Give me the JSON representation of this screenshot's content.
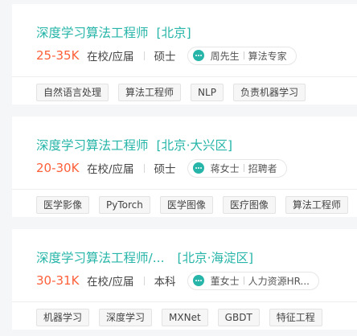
{
  "jobs": [
    {
      "title": "深度学习算法工程师",
      "city": "[北京]",
      "salary": "25-35K",
      "condition": "在校/应届",
      "degree": "硕士",
      "recruiter_name": "周先生",
      "recruiter_role": "算法专家",
      "tags": [
        "自然语言处理",
        "算法工程师",
        "NLP",
        "负责机器学习"
      ]
    },
    {
      "title": "深度学习算法工程师",
      "city": "[北京·大兴区]",
      "salary": "20-30K",
      "condition": "在校/应届",
      "degree": "硕士",
      "recruiter_name": "蒋女士",
      "recruiter_role": "招聘者",
      "tags": [
        "医学影像",
        "PyTorch",
        "医学图像",
        "医疗图像",
        "算法工程师"
      ]
    },
    {
      "title": "深度学习算法工程师/...",
      "city": "[北京·海淀区]",
      "salary": "30-31K",
      "condition": "在校/应届",
      "degree": "本科",
      "recruiter_name": "董女士",
      "recruiter_role": "人力资源HR...",
      "tags": [
        "机器学习",
        "深度学习",
        "MXNet",
        "GBDT",
        "特征工程"
      ]
    }
  ],
  "colors": {
    "title": "#26b5a8",
    "salary": "#fd5f39",
    "background": "#f5f6f8"
  },
  "icons": {
    "recruiter": "chat-bubble-icon"
  }
}
